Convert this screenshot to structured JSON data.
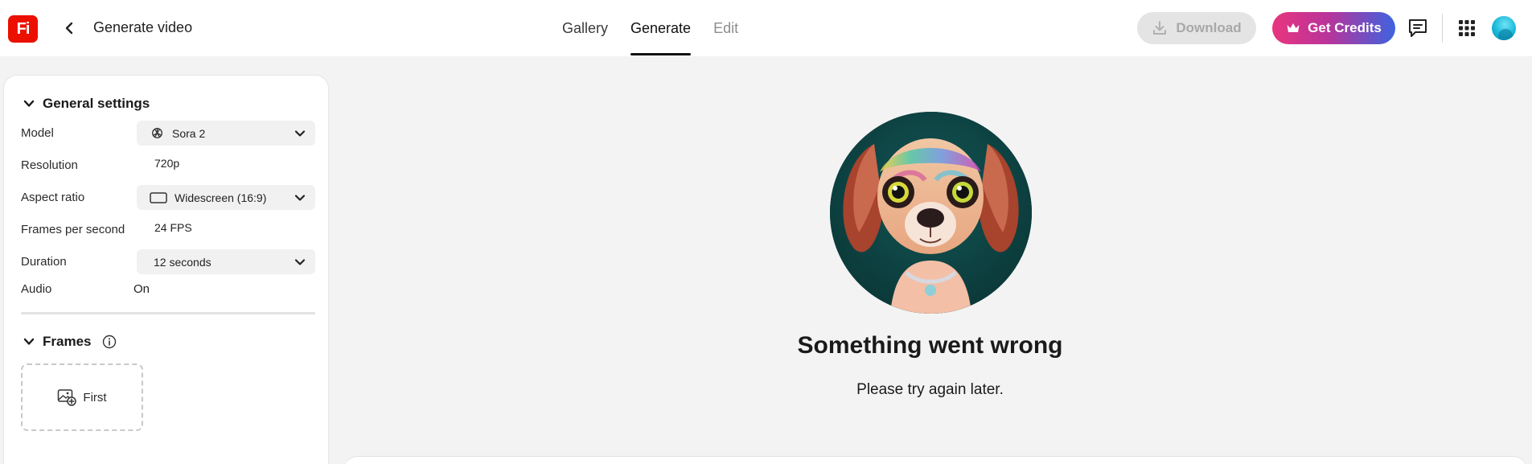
{
  "app": {
    "logo_text": "Fi",
    "title": "Generate video",
    "brand_color": "#eb1000"
  },
  "tabs": [
    {
      "label": "Gallery",
      "state": "normal"
    },
    {
      "label": "Generate",
      "state": "active"
    },
    {
      "label": "Edit",
      "state": "disabled"
    }
  ],
  "toolbar": {
    "download_label": "Download",
    "download_icon": "download-icon",
    "credits_label": "Get Credits",
    "credits_icon": "crown-icon",
    "feedback_icon": "chat-icon",
    "apps_icon": "app-grid-icon"
  },
  "general_settings": {
    "heading": "General settings",
    "rows": {
      "model": {
        "label": "Model",
        "value": "Sora 2",
        "icon": "openai-icon"
      },
      "resolution": {
        "label": "Resolution",
        "value": "720p"
      },
      "aspect_ratio": {
        "label": "Aspect ratio",
        "value": "Widescreen (16:9)",
        "icon": "widescreen-icon"
      },
      "fps": {
        "label": "Frames per second",
        "value": "24 FPS"
      },
      "duration": {
        "label": "Duration",
        "value": "12 seconds"
      },
      "audio": {
        "label": "Audio",
        "value": "On"
      }
    }
  },
  "frames": {
    "heading": "Frames",
    "info_icon": "info-icon",
    "first_label": "First",
    "first_icon": "add-image-icon"
  },
  "error": {
    "title": "Something went wrong",
    "message": "Please try again later."
  }
}
